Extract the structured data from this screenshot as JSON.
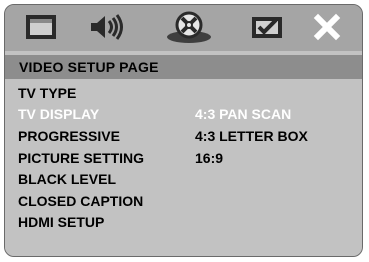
{
  "tabs": [
    {
      "icon": "display-icon",
      "selected": false
    },
    {
      "icon": "speaker-sound-icon",
      "selected": false
    },
    {
      "icon": "video-disc-icon",
      "selected": true
    },
    {
      "icon": "preferences-check-icon",
      "selected": false
    },
    {
      "icon": "close-icon",
      "selected": false
    }
  ],
  "page": {
    "title": "VIDEO SETUP PAGE"
  },
  "menu": {
    "items": [
      {
        "label": "TV TYPE",
        "highlighted": false
      },
      {
        "label": "TV DISPLAY",
        "highlighted": true
      },
      {
        "label": "PROGRESSIVE",
        "highlighted": false
      },
      {
        "label": "PICTURE SETTING",
        "highlighted": false
      },
      {
        "label": "BLACK LEVEL",
        "highlighted": false
      },
      {
        "label": "CLOSED CAPTION",
        "highlighted": false
      },
      {
        "label": "HDMI SETUP",
        "highlighted": false
      }
    ]
  },
  "options": {
    "items": [
      {
        "label": "4:3 PAN SCAN",
        "highlighted": true
      },
      {
        "label": "4:3 LETTER BOX",
        "highlighted": false
      },
      {
        "label": "16:9",
        "highlighted": false
      }
    ]
  },
  "colors": {
    "highlight_text": "#ffffff",
    "header_bg": "#8d8d8d",
    "panel_bg": "#c2c2c2"
  }
}
